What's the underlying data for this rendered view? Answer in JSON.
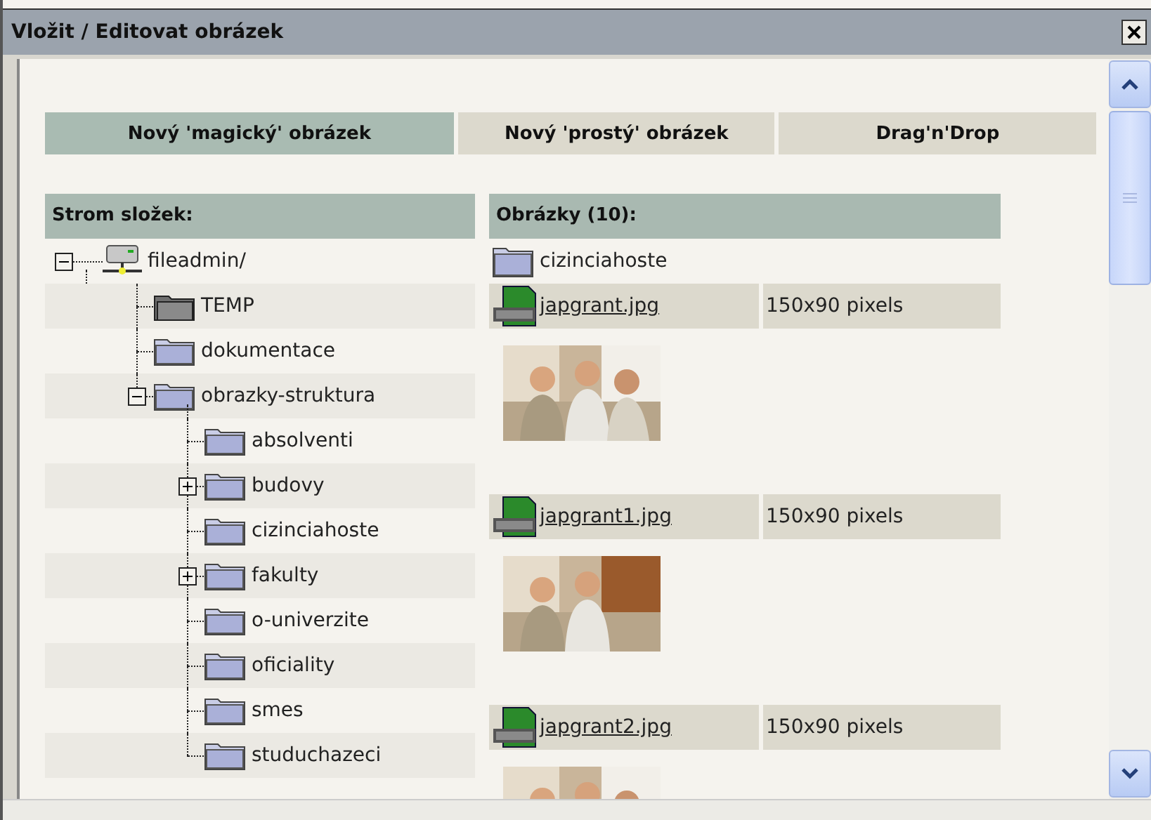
{
  "window": {
    "title": "Vložit / Editovat obrázek"
  },
  "tabs": [
    {
      "label": "Nový 'magický' obrázek",
      "selected": true
    },
    {
      "label": "Nový 'prostý' obrázek",
      "selected": false
    },
    {
      "label": "Drag'n'Drop",
      "selected": false
    }
  ],
  "tree": {
    "heading": "Strom složek:",
    "items": [
      {
        "label": "fileadmin/",
        "kind": "server",
        "expanded": true,
        "children": [
          {
            "label": "TEMP",
            "kind": "temp"
          },
          {
            "label": "dokumentace",
            "kind": "folder"
          },
          {
            "label": "obrazky-struktura",
            "kind": "folder",
            "expanded": true,
            "children": [
              {
                "label": "absolventi",
                "kind": "folder"
              },
              {
                "label": "budovy",
                "kind": "folder",
                "expanded": false
              },
              {
                "label": "cizinciahoste",
                "kind": "folder"
              },
              {
                "label": "fakulty",
                "kind": "folder",
                "expanded": false
              },
              {
                "label": "o-univerzite",
                "kind": "folder"
              },
              {
                "label": "oficiality",
                "kind": "folder"
              },
              {
                "label": "smes",
                "kind": "folder"
              },
              {
                "label": "studuchazeci",
                "kind": "folder"
              }
            ]
          }
        ]
      }
    ]
  },
  "images": {
    "heading": "Obrázky (10):",
    "items": [
      {
        "kind": "folder",
        "name": "cizinciahoste"
      },
      {
        "kind": "file",
        "name": "japgrant.jpg",
        "size": "150x90 pixels"
      },
      {
        "kind": "file",
        "name": "japgrant1.jpg",
        "size": "150x90 pixels"
      },
      {
        "kind": "file",
        "name": "japgrant2.jpg",
        "size": "150x90 pixels"
      }
    ]
  }
}
